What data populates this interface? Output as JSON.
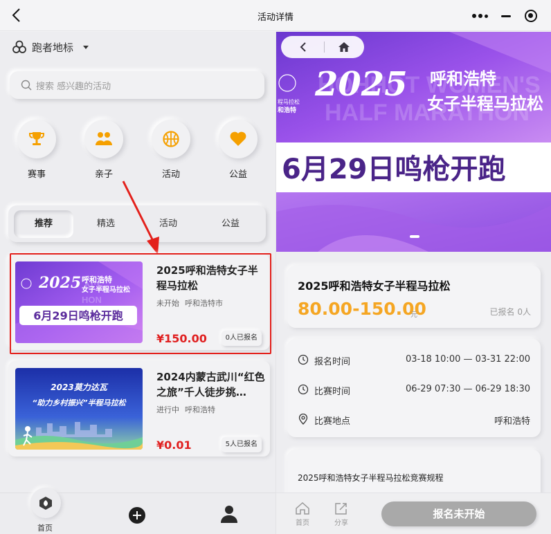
{
  "topbar": {
    "title": "活动详情"
  },
  "brand": {
    "name": "跑者地标"
  },
  "search": {
    "placeholder": "搜索 感兴趣的活动"
  },
  "categories": [
    {
      "label": "赛事",
      "icon": "trophy-icon"
    },
    {
      "label": "亲子",
      "icon": "family-icon"
    },
    {
      "label": "活动",
      "icon": "basketball-icon"
    },
    {
      "label": "公益",
      "icon": "heart-icon"
    }
  ],
  "tabs": [
    {
      "label": "推荐",
      "active": true
    },
    {
      "label": "精选"
    },
    {
      "label": "活动"
    },
    {
      "label": "公益"
    }
  ],
  "events": [
    {
      "title": "2025呼和浩特女子半程马拉松",
      "status": "未开始",
      "city": "呼和浩特市",
      "price": "¥150.00",
      "registered": "0人已报名",
      "image": {
        "year": "2025",
        "city_name": "呼和浩特",
        "subtitle": "女子半程马拉松",
        "english": "WOMEN'S HALF MARATHON",
        "tagline": "6月29日鸣枪开跑"
      }
    },
    {
      "title": "2024内蒙古武川“红色之旅”千人徒步挑…",
      "status": "进行中",
      "city": "呼和浩特",
      "price": "¥0.01",
      "registered": "5人已报名",
      "image": {
        "line1": "2023莫力达瓦",
        "line2": "“助力乡村振兴”半程马拉松"
      }
    }
  ],
  "bottom_nav": {
    "home_label": "首页"
  },
  "detail": {
    "banner": {
      "year": "2025",
      "city_name": "呼和浩特",
      "subtitle": "女子半程马拉松",
      "english_line1": "HOHHOT WOMEN'S",
      "english_line2": "HALF MARATHON",
      "logo_text": "和浩特",
      "logo_text2": "程马拉松",
      "tagline": "6月29日鸣枪开跑"
    },
    "title": "2025呼和浩特女子半程马拉松",
    "price": "80.00-150.00",
    "price_unit": "元",
    "registered": "已报名 0人",
    "rows": [
      {
        "label": "报名时间",
        "value": "03-18 10:00 — 03-31 22:00",
        "icon": "clock-icon"
      },
      {
        "label": "比赛时间",
        "value": "06-29 07:30 — 06-29 18:30",
        "icon": "clock-icon"
      },
      {
        "label": "比赛地点",
        "value": "呼和浩特",
        "icon": "location-icon"
      }
    ],
    "rules_title": "2025呼和浩特女子半程马拉松竞赛规程",
    "bar": {
      "home_label": "首页",
      "share_label": "分享",
      "signup_label": "报名未开始"
    }
  },
  "colors": {
    "price_red": "#e02020",
    "price_orange": "#f5a623",
    "highlight_red": "#e3201b",
    "banner_purple": "#8a4fd8"
  }
}
